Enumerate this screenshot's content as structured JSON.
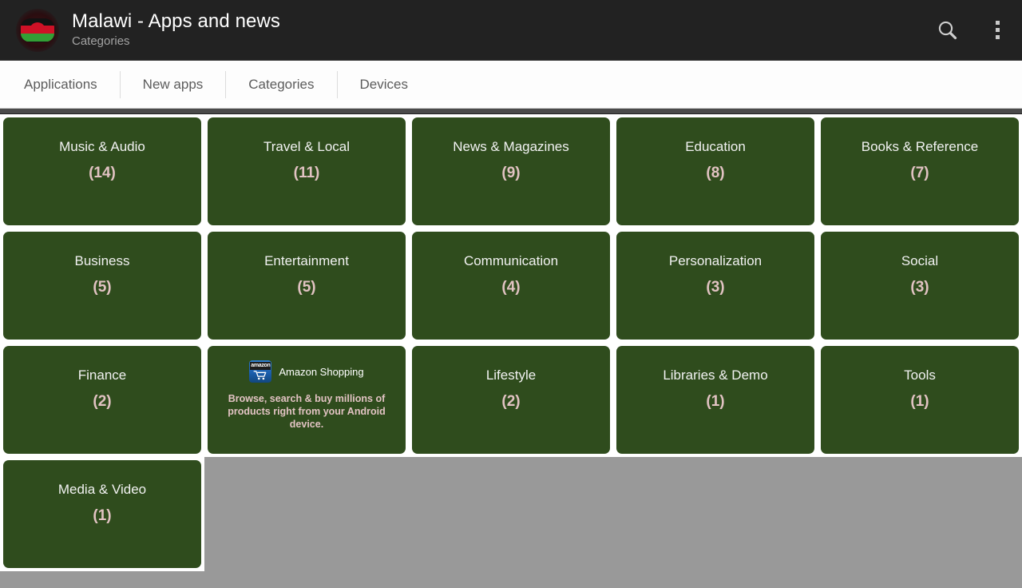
{
  "header": {
    "title": "Malawi - Apps and news",
    "subtitle": "Categories",
    "app_icon": "malawi-flag-icon",
    "search_icon": "search-icon",
    "overflow_icon": "overflow-menu-icon",
    "background_color": "#222222",
    "title_color": "#ffffff",
    "subtitle_color": "#a3a3a3"
  },
  "tabs": [
    {
      "label": "Applications",
      "selected": false
    },
    {
      "label": "New apps",
      "selected": false
    },
    {
      "label": "Categories",
      "selected": true
    },
    {
      "label": "Devices",
      "selected": false
    }
  ],
  "theme": {
    "tile_green": "#2f4c1d",
    "count_pink": "#e2c3c3",
    "page_gray": "#999999",
    "tab_text": "#5c5c5c",
    "tabbar_bg": "#fdfdfd"
  },
  "grid": {
    "columns": 5,
    "rows": [
      [
        {
          "kind": "category",
          "name": "Music & Audio",
          "count": "(14)"
        },
        {
          "kind": "category",
          "name": "Travel & Local",
          "count": "(11)"
        },
        {
          "kind": "category",
          "name": "News & Magazines",
          "count": "(9)"
        },
        {
          "kind": "category",
          "name": "Education",
          "count": "(8)"
        },
        {
          "kind": "category",
          "name": "Books & Reference",
          "count": "(7)"
        }
      ],
      [
        {
          "kind": "category",
          "name": "Business",
          "count": "(5)"
        },
        {
          "kind": "category",
          "name": "Entertainment",
          "count": "(5)"
        },
        {
          "kind": "category",
          "name": "Communication",
          "count": "(4)"
        },
        {
          "kind": "category",
          "name": "Personalization",
          "count": "(3)"
        },
        {
          "kind": "category",
          "name": "Social",
          "count": "(3)"
        }
      ],
      [
        {
          "kind": "category",
          "name": "Finance",
          "count": "(2)"
        },
        {
          "kind": "ad",
          "ad_title": "Amazon Shopping",
          "ad_body": "Browse, search & buy millions of products right from your Android device.",
          "ad_icon_word": "amazon",
          "ad_icon": "amazon-shopping-icon"
        },
        {
          "kind": "category",
          "name": "Lifestyle",
          "count": "(2)"
        },
        {
          "kind": "category",
          "name": "Libraries & Demo",
          "count": "(1)"
        },
        {
          "kind": "category",
          "name": "Tools",
          "count": "(1)"
        }
      ],
      [
        {
          "kind": "category",
          "name": "Media & Video",
          "count": "(1)"
        },
        {
          "kind": "empty"
        },
        {
          "kind": "empty"
        },
        {
          "kind": "empty"
        },
        {
          "kind": "empty"
        }
      ]
    ]
  }
}
